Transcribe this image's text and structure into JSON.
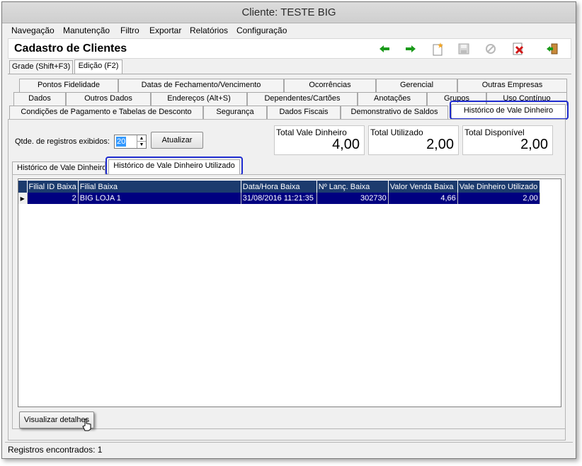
{
  "window": {
    "title": "Cliente: TESTE BIG"
  },
  "menu": [
    {
      "label": "Navegação"
    },
    {
      "label": "Manutenção"
    },
    {
      "label": "Filtro"
    },
    {
      "label": "Exportar"
    },
    {
      "label": "Relatórios"
    },
    {
      "label": "Configuração"
    }
  ],
  "form": {
    "title": "Cadastro de Clientes"
  },
  "toolbar": {
    "icons": [
      "arrow-left-icon",
      "arrow-right-icon",
      "new-icon",
      "save-icon",
      "cancel-icon",
      "delete-icon",
      "exit-icon"
    ],
    "colors": {
      "arrows": "#1a9a1a",
      "delete": "#d01818"
    }
  },
  "view_tabs": {
    "grid": "Grade (Shift+F3)",
    "edit": "Edição (F2)"
  },
  "tabs": {
    "row1": [
      "Pontos Fidelidade",
      "Datas de Fechamento/Vencimento",
      "Ocorrências",
      "Gerencial",
      "Outras Empresas"
    ],
    "row2": [
      "Dados",
      "Outros Dados",
      "Endereços (Alt+S)",
      "Dependentes/Cartões",
      "Anotações",
      "Grupos",
      "Uso Contínuo"
    ],
    "row3": [
      "Condições de Pagamento e Tabelas de Desconto",
      "Segurança",
      "Dados Fiscais",
      "Demonstrativo de Saldos",
      "Histórico de Vale Dinheiro"
    ]
  },
  "filter": {
    "label": "Qtde. de registros exibidos:",
    "value": "20",
    "refresh_button": "Atualizar"
  },
  "totals": {
    "total_label": "Total Vale Dinheiro",
    "total_value": "4,00",
    "used_label": "Total Utilizado",
    "used_value": "2,00",
    "available_label": "Total Disponível",
    "available_value": "2,00"
  },
  "subtabs": {
    "history": "Histórico de Vale Dinheiro",
    "used": "Histórico de Vale Dinheiro Utilizado"
  },
  "grid": {
    "columns": [
      "Filial ID Baixa",
      "Filial Baixa",
      "Data/Hora Baixa",
      "Nº Lanç. Baixa",
      "Valor Venda Baixa",
      "Vale Dinheiro Utilizado"
    ],
    "rows": [
      [
        "2",
        "BIG LOJA 1",
        "31/08/2016 11:21:35",
        "302730",
        "4,66",
        "2,00"
      ]
    ]
  },
  "details_button": "Visualizar detalhes",
  "status": {
    "text": "Registros encontrados: 1"
  },
  "accent": {
    "highlight": "#1e2bcf",
    "header": "#1c3b6e",
    "selection": "#000080"
  }
}
